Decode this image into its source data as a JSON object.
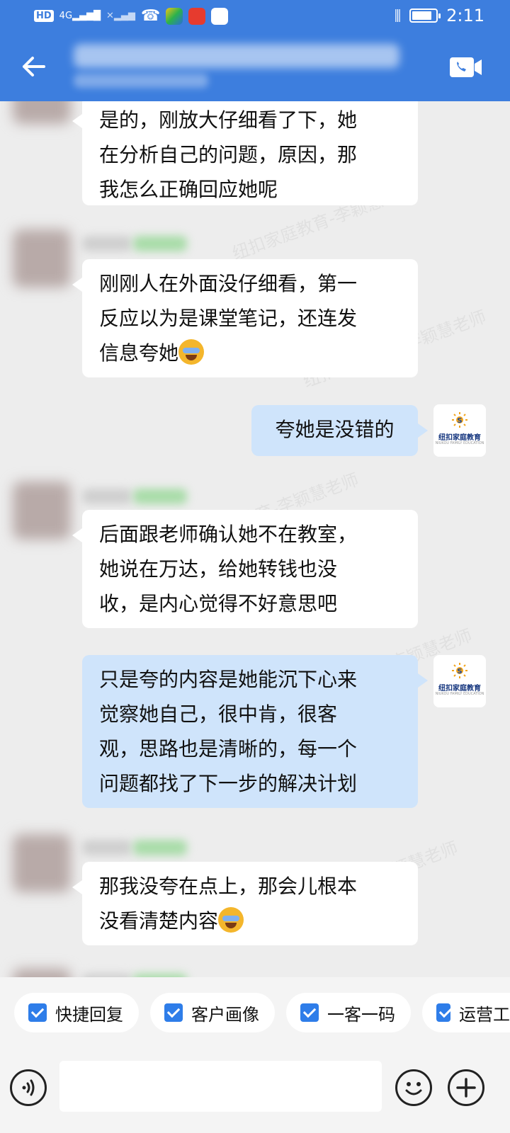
{
  "status_bar": {
    "hd_label": "HD",
    "network_label": "4G",
    "time": "2:11",
    "battery_level": 0.85,
    "icons": [
      "hd-icon",
      "signal-icon",
      "no-signal-icon",
      "missed-call-icon",
      "app-icon",
      "app-icon",
      "baidu-icon",
      "vibrate-icon",
      "battery-icon"
    ]
  },
  "header": {
    "back_icon": "arrow-left-icon",
    "video_call_icon": "video-call-icon"
  },
  "messages": [
    {
      "side": "left",
      "text": "是的，刚放大仔细看了下，她在分析自己的问题，原因，那我怎么正确回应她呢"
    },
    {
      "side": "left",
      "text": "刚刚人在外面没仔细看，第一反应以为是课堂笔记，还连发信息夸她",
      "emoji": "cry-laugh-emoji"
    },
    {
      "side": "right",
      "text": "夸她是没错的"
    },
    {
      "side": "left",
      "text": "后面跟老师确认她不在教室，她说在万达，给她转钱也没收，是内心觉得不好意思吧"
    },
    {
      "side": "right",
      "text": "只是夸的内容是她能沉下心来觉察她自己，很中肯，很客观，思路也是清晰的，每一个问题都找了下一步的解决计划"
    },
    {
      "side": "left",
      "text": "那我没夸在点上，那会儿根本没看清楚内容",
      "emoji": "cry-laugh-emoji"
    }
  ],
  "message_lines": {
    "m1": [
      "是的，刚放大仔细看了下，她",
      "在分析自己的问题，原因，那",
      "我怎么正确回应她呢"
    ],
    "m2": [
      "刚刚人在外面没仔细看，第一",
      "反应以为是课堂笔记，还连发",
      "信息夸她"
    ],
    "m3": [
      "夸她是没错的"
    ],
    "m4": [
      "后面跟老师确认她不在教室，",
      "她说在万达，给她转钱也没",
      "收，是内心觉得不好意思吧"
    ],
    "m5": [
      "只是夸的内容是她能沉下心来",
      "觉察她自己，很中肯，很客",
      "观，思路也是清晰的，每一个",
      "问题都找了下一步的解决计划"
    ],
    "m6": [
      "那我没夸在点上，那会儿根本",
      "没看清楚内容"
    ]
  },
  "self_avatar": {
    "logo_text": "纽扣家庭教育",
    "logo_sub": "NIUKOU FAMILY EDUCATION"
  },
  "watermark_text": "纽扣家庭教育-李颖慧老师",
  "quick_tabs": [
    {
      "label": "快捷回复",
      "checked": true
    },
    {
      "label": "客户画像",
      "checked": true
    },
    {
      "label": "一客一码",
      "checked": true
    },
    {
      "label": "运营工",
      "checked": true
    }
  ],
  "input": {
    "placeholder": "",
    "voice_icon": "voice-icon",
    "emoji_icon": "smiley-icon",
    "plus_icon": "plus-icon"
  },
  "colors": {
    "header": "#3d7ede",
    "background": "#ededed",
    "incoming_bubble": "#ffffff",
    "outgoing_bubble": "#cfe4fb",
    "check": "#2e7de9"
  }
}
